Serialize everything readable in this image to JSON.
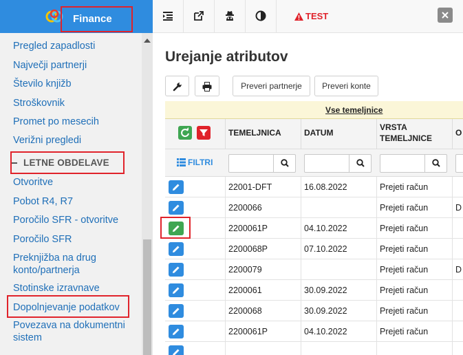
{
  "brand": {
    "title": "Finance"
  },
  "sidebar": {
    "items_top": [
      "Pregled zapadlosti",
      "Največji partnerji",
      "Število knjižb",
      "Stroškovnik",
      "Promet po mesecih",
      "Verižni pregledi"
    ],
    "section": "LETNE OBDELAVE",
    "items_bottom": [
      "Otvoritve",
      "Pobot R4, R7",
      "Poročilo SFR - otvoritve",
      "Poročilo SFR",
      "Preknjižba na drug konto/partnerja",
      "Stotinske izravnave",
      "Dopolnjevanje podatkov",
      "Povezava na dokumentni sistem"
    ]
  },
  "topbar": {
    "test_label": "TEST",
    "accent_color": "#e0222a"
  },
  "main": {
    "title": "Urejanje atributov",
    "buttons": {
      "preveri_partnerje": "Preveri partnerje",
      "preveri_konte": "Preveri konte"
    }
  },
  "grid": {
    "title_link": "Vse temeljnice",
    "filter_label": "FILTRI",
    "columns": [
      "TEMELJNICA",
      "DATUM",
      "VRSTA TEMELJNICE",
      "O"
    ],
    "rows": [
      {
        "temeljnica": "22001-DFT",
        "datum": "16.08.2022",
        "vrsta": "Prejeti račun",
        "extra": ""
      },
      {
        "temeljnica": "2200066",
        "datum": "",
        "vrsta": "Prejeti račun",
        "extra": "D"
      },
      {
        "temeljnica": "2200061P",
        "datum": "04.10.2022",
        "vrsta": "Prejeti račun",
        "extra": ""
      },
      {
        "temeljnica": "2200068P",
        "datum": "07.10.2022",
        "vrsta": "Prejeti račun",
        "extra": ""
      },
      {
        "temeljnica": "2200079",
        "datum": "",
        "vrsta": "Prejeti račun",
        "extra": "D"
      },
      {
        "temeljnica": "2200061",
        "datum": "30.09.2022",
        "vrsta": "Prejeti račun",
        "extra": ""
      },
      {
        "temeljnica": "2200068",
        "datum": "30.09.2022",
        "vrsta": "Prejeti račun",
        "extra": ""
      },
      {
        "temeljnica": "2200061P",
        "datum": "04.10.2022",
        "vrsta": "Prejeti račun",
        "extra": ""
      },
      {
        "temeljnica": "",
        "datum": "",
        "vrsta": "",
        "extra": ""
      }
    ]
  },
  "colors": {
    "brand": "#2f8cdf",
    "highlight": "#e0222a",
    "edit_green": "#3fa652"
  }
}
